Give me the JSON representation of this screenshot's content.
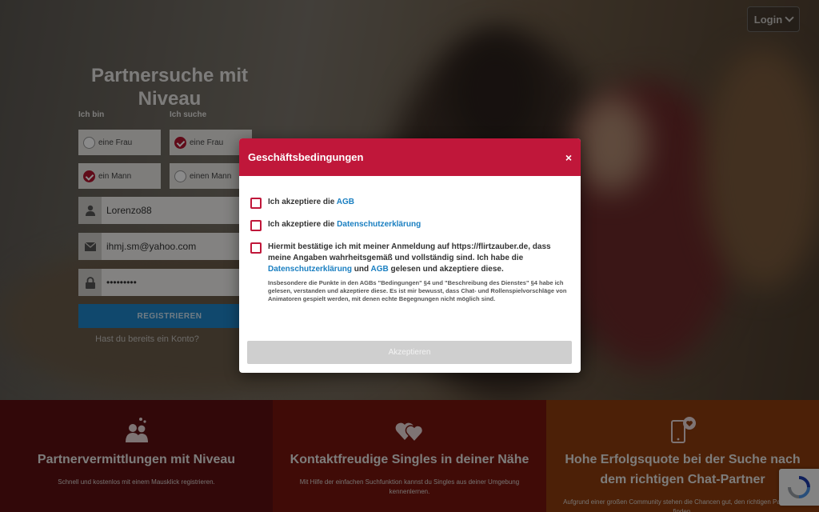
{
  "header": {
    "login_label": "Login"
  },
  "hero": {
    "title": "Partnersuche mit Niveau",
    "i_am_label": "Ich bin",
    "looking_for_label": "Ich suche",
    "options": {
      "i_am_woman": "eine Frau",
      "i_am_man": "ein Mann",
      "seek_woman": "eine Frau",
      "seek_man": "einen Mann"
    },
    "username_value": "Lorenzo88",
    "email_value": "ihmj.sm@yahoo.com",
    "password_value": "•••••••••",
    "register_label": "REGISTRIEREN",
    "have_account_text": "Hast du bereits ein Konto?"
  },
  "features": [
    {
      "title": "Partnervermittlungen mit Niveau",
      "text": "Schnell und kostenlos mit einem Mausklick registrieren.",
      "icon": "people-hearts-icon",
      "color": "#5d0f12"
    },
    {
      "title": "Kontaktfreudige Singles in deiner Nähe",
      "text": "Mit Hilfe der einfachen Suchfunktion kannst du Singles aus deiner Umgebung kennenlernen.",
      "icon": "hearts-icon",
      "color": "#76150e"
    },
    {
      "title": "Hohe Erfolgsquote bei der Suche nach dem richtigen Chat-Partner",
      "text": "Aufgrund einer großen Community stehen die Chancen gut, den richtigen Partner zu finden.",
      "icon": "phone-heart-icon",
      "color": "#8c3c0d"
    }
  ],
  "modal": {
    "title": "Geschäftsbedingungen",
    "close": "×",
    "item1_prefix": "Ich akzeptiere die ",
    "item1_link": "AGB",
    "item2_prefix": "Ich akzeptiere die ",
    "item2_link": "Datenschutzerklärung",
    "item3_part1": "Hiermit bestätige ich mit meiner Anmeldung auf https://flirtzauber.de, dass meine Angaben wahrheitsgemäß und vollständig sind. Ich habe die ",
    "item3_link1": "Datenschutzerklärung",
    "item3_part2": " und ",
    "item3_link2": "AGB",
    "item3_part3": " gelesen und akzeptiere diese.",
    "item3_small": "Insbesondere die Punkte in den AGBs \"Bedingungen\" §4 und \"Beschreibung des Dienstes\" §4 habe ich gelesen, verstanden und akzeptiere diese. Es ist mir bewusst, dass Chat- und Rollenspielvorschläge von Animatoren gespielt werden, mit denen echte Begegnungen nicht möglich sind.",
    "accept_label": "Akzeptieren"
  },
  "colors": {
    "brand_red": "#c0173a",
    "link_blue": "#1a7fc1",
    "register_blue": "#1f86c9"
  }
}
